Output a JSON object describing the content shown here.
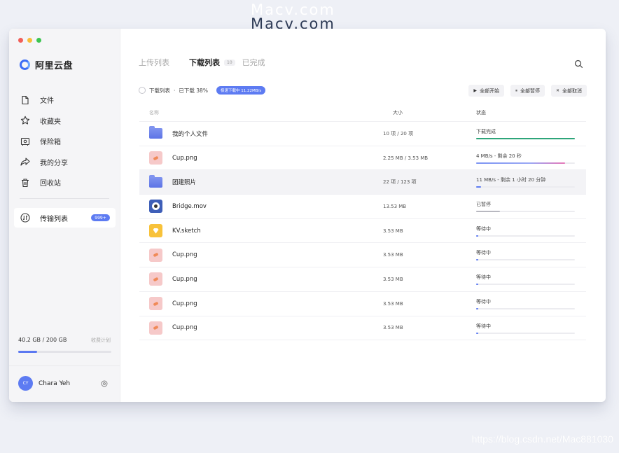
{
  "watermark_top": "Macv.com",
  "watermark_bottom": "https://blog.csdn.net/Mac881030",
  "colors": {
    "accent": "#5d7bf2",
    "done": "#2ea57a",
    "window_bg": "#ffffff",
    "sidebar_bg": "#f5f5f7"
  },
  "sidebar": {
    "app_name": "阿里云盘",
    "items": [
      {
        "label": "文件",
        "icon": "file-icon"
      },
      {
        "label": "收藏夹",
        "icon": "star-icon"
      },
      {
        "label": "保险箱",
        "icon": "safe-icon"
      },
      {
        "label": "我的分享",
        "icon": "share-icon"
      },
      {
        "label": "回收站",
        "icon": "trash-icon"
      }
    ],
    "transfer": {
      "label": "传输列表",
      "badge": "999+",
      "icon": "transfer-icon"
    },
    "storage": {
      "used_text": "40.2 GB / 200 GB",
      "plan_label": "收费计划",
      "fraction": 0.201
    },
    "user": {
      "initials": "CY",
      "name": "Chara Yeh"
    }
  },
  "header": {
    "tabs": [
      {
        "label": "上传列表"
      },
      {
        "label": "下载列表",
        "count": "10"
      },
      {
        "label": "已完成"
      }
    ]
  },
  "status_bar": {
    "list_label": "下载列表",
    "separator": "·",
    "progress_text": "已下载 38%",
    "speed_text": "极速下载中 11.22MB/s"
  },
  "actions": {
    "start_all": "全部开始",
    "pause_all": "全部暂停",
    "cancel_all": "全部取消"
  },
  "table": {
    "columns": {
      "name": "名称",
      "size": "大小",
      "status": "状态"
    },
    "rows": [
      {
        "name": "我的个人文件",
        "type": "folder",
        "size": "10 项 / 20 项",
        "status": "下载完成",
        "progress": 1.0
      },
      {
        "name": "Cup.png",
        "type": "image",
        "size": "2.25 MB / 3.53 MB",
        "status": "4 MB/s - 剩余 20 秒",
        "progress": 0.9
      },
      {
        "name": "团建照片",
        "type": "folder",
        "size": "22 项 / 123 项",
        "status": "11 MB/s - 剩余 1 小时 20 分钟",
        "progress": 0.05
      },
      {
        "name": "Bridge.mov",
        "type": "video",
        "size": "13.53 MB",
        "status": "已暂停",
        "progress": 0.24
      },
      {
        "name": "KV.sketch",
        "type": "sketch",
        "size": "3.53 MB",
        "status": "等待中",
        "progress": 0.02
      },
      {
        "name": "Cup.png",
        "type": "image",
        "size": "3.53 MB",
        "status": "等待中",
        "progress": 0.02
      },
      {
        "name": "Cup.png",
        "type": "image",
        "size": "3.53 MB",
        "status": "等待中",
        "progress": 0.02
      },
      {
        "name": "Cup.png",
        "type": "image",
        "size": "3.53 MB",
        "status": "等待中",
        "progress": 0.02
      },
      {
        "name": "Cup.png",
        "type": "image",
        "size": "3.53 MB",
        "status": "等待中",
        "progress": 0.02
      }
    ]
  }
}
